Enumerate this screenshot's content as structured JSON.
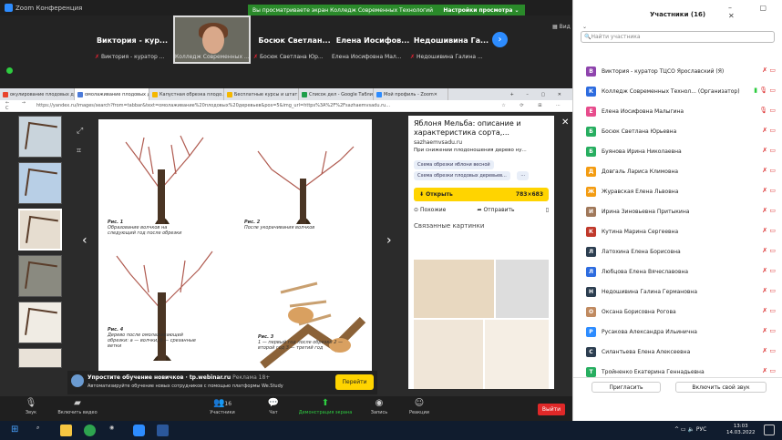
{
  "window": {
    "title": "Zoom Конференция"
  },
  "banner": {
    "message": "Вы просматриваете экран Колледж Современных Технологий",
    "options": "Настройки просмотра ⌄"
  },
  "strip": {
    "tiles": [
      {
        "name": "Виктория - кур...",
        "label": "Виктория - куратор ..."
      },
      {
        "name": "",
        "label": "Колледж Современных ..."
      },
      {
        "name": "Босюк Светлан...",
        "label": "Босюк Светлана Юр..."
      },
      {
        "name": "Елена Иосифов...",
        "label": "Елена Иосифовна Мал..."
      },
      {
        "name": "Недошивина Га...",
        "label": "Недошивина Галина ..."
      }
    ],
    "view_label": "Вид"
  },
  "browser": {
    "tabs": [
      {
        "label": "окулирование плодовых дер...",
        "color": "#e8442c"
      },
      {
        "label": "омолаживание плодовых дер...",
        "color": "#4c7bd9",
        "active": true
      },
      {
        "label": "Капустная обрезка плодо...",
        "color": "#f5b800"
      },
      {
        "label": "Бесплатные курсы и штат...",
        "color": "#f5b800"
      },
      {
        "label": "Список дел - Google Таблиц...",
        "color": "#1e9e4a"
      },
      {
        "label": "Мой профиль - Zoom",
        "color": "#2d8cff"
      }
    ],
    "url": "https://yandex.ru/images/search?from=tabbar&text=омолаживание%20плодовых%20деревьев&pos=5&img_url=https%3A%2F%2Fsazhaemvsadu.ru..."
  },
  "viewer": {
    "title": "Яблоня Мельба: описание и характеристика сорта,...",
    "source": "sazhaemvsadu.ru",
    "desc": "При снижении плодоношения дерево ну...",
    "chips": [
      "Схема обрезки яблони весной",
      "Схема обрезки плодовых деревьев...",
      "···"
    ],
    "open_label": "Открыть",
    "size": "783×683",
    "similar": "Похожие",
    "send": "Отправить",
    "related": "Связанные картинки",
    "figs": [
      {
        "cap": "Рис. 1",
        "text": "Образование волчков на следующий год после обрезки"
      },
      {
        "cap": "Рис. 2",
        "text": "После укорачивания волчков"
      },
      {
        "cap": "Рис. 4",
        "text": "Дерево после омолаживающей обрезки: а — волчки, б — срезанные ветки"
      },
      {
        "cap": "Рис. 3",
        "text": "1 — первый год после обрезки 2 — второй год 3 — третий год"
      }
    ]
  },
  "ad": {
    "title": "Упростите обучение новичков · tp.webinar.ru",
    "badge": "Реклама 18+",
    "text": "Автоматизируйте обучение новых сотрудников с помощью платформы We.Study",
    "cta": "Перейти"
  },
  "toolbar": {
    "audio": "Звук",
    "video": "Включить видео",
    "participants": "Участники",
    "count": "16",
    "chat": "Чат",
    "share": "Демонстрация экрана",
    "record": "Запись",
    "reactions": "Реакции",
    "leave": "Выйти"
  },
  "panel": {
    "title": "Участники (16)",
    "search_placeholder": "Найти участника",
    "invite": "Пригласить",
    "unmute": "Включить свой звук",
    "participants": [
      {
        "initial": "В",
        "color": "#8e44ad",
        "name": "Виктория - куратор ТЦСО Ярославский (Я)"
      },
      {
        "initial": "К",
        "color": "#2d6cdf",
        "name": "Колледж Современных Технол... (Организатор)"
      },
      {
        "initial": "Е",
        "color": "#e74c8c",
        "name": "Елена Иосифовна Малыгина"
      },
      {
        "initial": "Б",
        "color": "#27ae60",
        "name": "Босюк Светлана Юрьевна"
      },
      {
        "initial": "Б",
        "color": "#27ae60",
        "name": "Буянова Ирина Николаевна"
      },
      {
        "initial": "Д",
        "color": "#f39c12",
        "name": "Довгаль Лариса Климовна"
      },
      {
        "initial": "Ж",
        "color": "#f39c12",
        "name": "Журавская Елена Львовна"
      },
      {
        "initial": "И",
        "color": "#a0785a",
        "name": "Ирина Зиновьевна Притыкина"
      },
      {
        "initial": "К",
        "color": "#c0392b",
        "name": "Кутина Марина Сергеевна"
      },
      {
        "initial": "Л",
        "color": "#2c3e50",
        "name": "Латохина Елена Борисовна"
      },
      {
        "initial": "Л",
        "color": "#2d6cdf",
        "name": "Любцова Елена Вячеславовна"
      },
      {
        "initial": "Н",
        "color": "#2c3e50",
        "name": "Недошивина Галина Германовна"
      },
      {
        "initial": "О",
        "color": "#c08a60",
        "name": "Оксана Борисовна Рогова"
      },
      {
        "initial": "Р",
        "color": "#2d8cff",
        "name": "Русакова Александра Ильинична"
      },
      {
        "initial": "С",
        "color": "#2c3e50",
        "name": "Силантьева Елена Алексеевна"
      },
      {
        "initial": "Т",
        "color": "#27ae60",
        "name": "Тройненко Екатерина Геннадьевна"
      }
    ]
  },
  "taskbar": {
    "lang": "РУС",
    "time": "13:03",
    "date": "14.03.2022"
  }
}
